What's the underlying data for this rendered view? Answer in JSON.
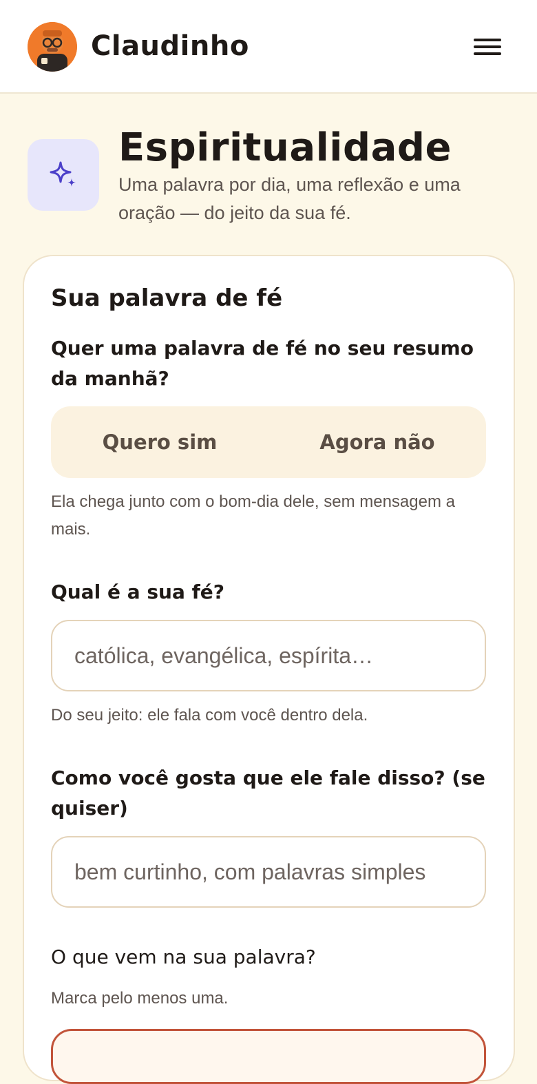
{
  "header": {
    "brand_name": "Claudinho",
    "avatar_icon": "claudinho-avatar",
    "menu_icon": "hamburger-menu-icon"
  },
  "hero": {
    "icon": "sparkles-icon",
    "title": "Espiritualidade",
    "subtitle": "Uma palavra por dia, uma reflexão e uma oração — do jeito da sua fé."
  },
  "card": {
    "title": "Sua palavra de fé",
    "morning_question": {
      "label": "Quer uma palavra de fé no seu resumo da manhã?",
      "options": [
        "Quero sim",
        "Agora não"
      ],
      "hint": "Ela chega junto com o bom-dia dele, sem mensagem a mais."
    },
    "faith_question": {
      "label": "Qual é a sua fé?",
      "value": "",
      "placeholder": "católica, evangélica, espírita…",
      "hint": "Do seu jeito: ele fala com você dentro dela."
    },
    "style_question": {
      "label": "Como você gosta que ele fale disso? (se quiser)",
      "value": "",
      "placeholder": "bem curtinho, com palavras simples"
    },
    "content_question": {
      "label": "O que vem na sua palavra?",
      "hint": "Marca pelo menos uma."
    }
  },
  "colors": {
    "page_background": "#fdf8e8",
    "accent_purple": "#4b3fc9",
    "icon_box": "#e7e6fb",
    "toggle_background": "#fbf2e0",
    "avatar_orange": "#f07a2a",
    "selected_border": "#c2543a"
  }
}
